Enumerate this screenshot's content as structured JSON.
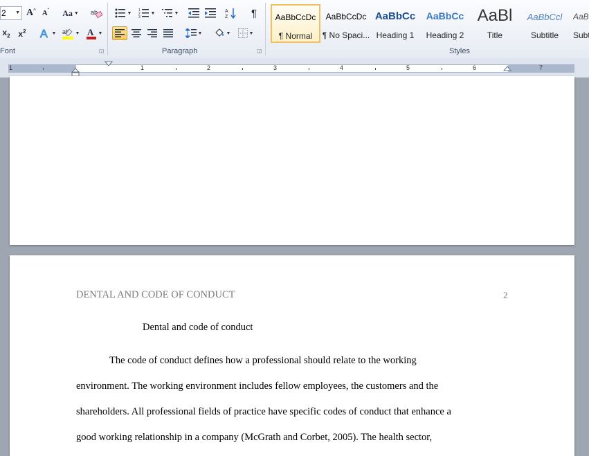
{
  "font_group": {
    "font_size": "2",
    "grow_label": "A",
    "shrink_label": "A",
    "change_case_label": "Aa",
    "subscript_label": "x",
    "superscript_label": "x",
    "label": "Font"
  },
  "paragraph_group": {
    "label": "Paragraph",
    "show_marks_label": "¶"
  },
  "styles_group": {
    "label": "Styles",
    "tiles": [
      {
        "sample": "AaBbCcDc",
        "name": "¶ Normal"
      },
      {
        "sample": "AaBbCcDc",
        "name": "¶ No Spaci..."
      },
      {
        "sample": "AaBbCc",
        "name": "Heading 1"
      },
      {
        "sample": "AaBbCc",
        "name": "Heading 2"
      },
      {
        "sample": "AaBl",
        "name": "Title"
      },
      {
        "sample": "AaBbCcl",
        "name": "Subtitle"
      },
      {
        "sample": "AaB",
        "name": "Subt"
      }
    ]
  },
  "ruler": {
    "numbers": [
      "1",
      "1",
      "2",
      "3",
      "4",
      "5",
      "6",
      "7"
    ]
  },
  "document": {
    "running_header": "DENTAL AND CODE OF CONDUCT",
    "page_number": "2",
    "title": "Dental and code of conduct",
    "lines": [
      "The code of conduct defines how a professional should relate to the working",
      "environment. The working environment includes fellow employees, the customers and the",
      "shareholders. All professional  fields of practice have specific codes of conduct that enhance a",
      "good working relationship  in a company (McGrath and Corbet, 2005). The health sector,"
    ]
  },
  "colors": {
    "highlight": "#ffff00",
    "font_color": "#d0191b",
    "active_style_border": "#f1c15f",
    "heading_blue": "#1f4f8f"
  }
}
